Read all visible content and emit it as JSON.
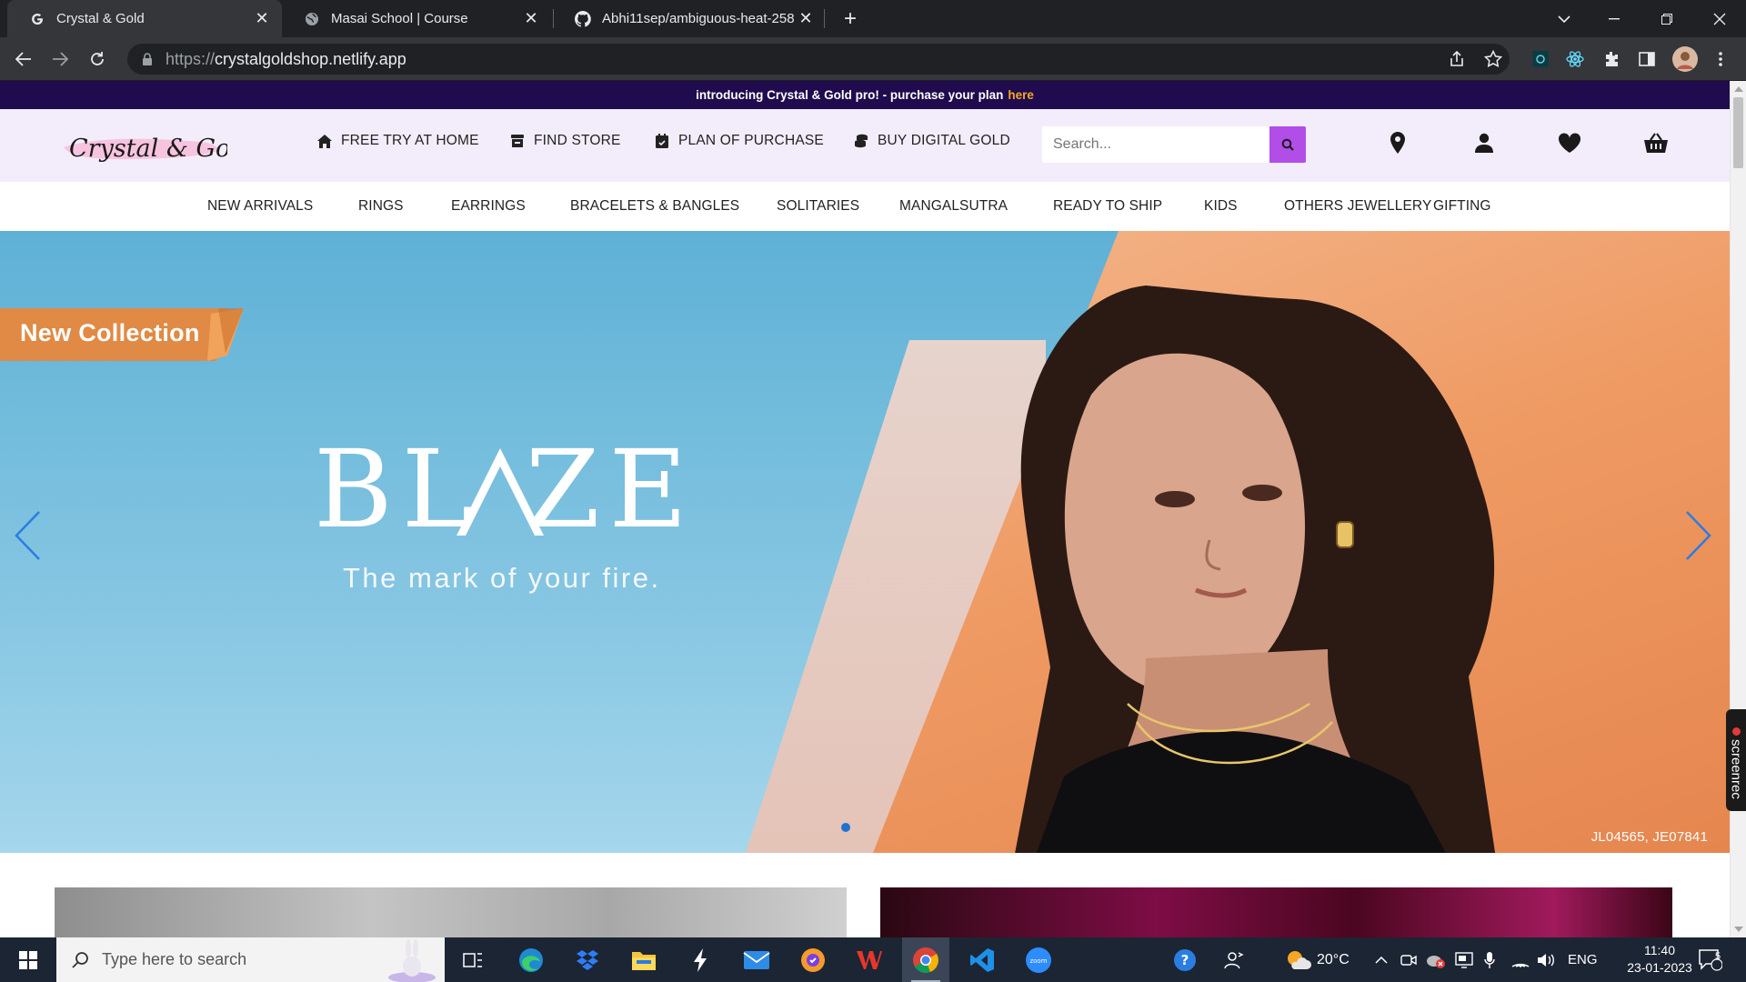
{
  "browser": {
    "tabs": [
      {
        "title": "Crystal & Gold",
        "active": true
      },
      {
        "title": "Masai School | Course",
        "active": false
      },
      {
        "title": "Abhi11sep/ambiguous-heat-258",
        "active": false
      }
    ],
    "url_scheme": "https://",
    "url_host": "crystalgoldshop.netlify.app"
  },
  "announcement": {
    "text": "introducing Crystal & Gold pro! - purchase your plan",
    "link": "here"
  },
  "header": {
    "logo_text": "Crystal & Gold",
    "links": [
      {
        "label": "FREE TRY AT HOME",
        "icon": "home-icon"
      },
      {
        "label": "FIND STORE",
        "icon": "store-icon"
      },
      {
        "label": "PLAN OF PURCHASE",
        "icon": "calendar-icon"
      },
      {
        "label": "BUY DIGITAL GOLD",
        "icon": "coins-icon"
      }
    ],
    "search_placeholder": "Search...",
    "icons": [
      "location-pin-icon",
      "user-icon",
      "heart-icon",
      "basket-icon"
    ]
  },
  "categories": [
    "NEW ARRIVALS",
    "RINGS",
    "EARRINGS",
    "BRACELETS & BANGLES",
    "SOLITARIES",
    "MANGALSUTRA",
    "READY TO SHIP",
    "KIDS",
    "OTHERS JEWELLERY",
    "GIFTING"
  ],
  "hero": {
    "ribbon": "New Collection",
    "headline": "BL  ZE",
    "tagline": "The mark of your fire.",
    "sku": "JL04565, JE07841",
    "accent": "#1e73d2"
  },
  "side_tab": "screenrec",
  "taskbar": {
    "search_placeholder": "Type here to search",
    "weather": "20°C",
    "lang": "ENG",
    "time": "11:40",
    "date": "23-01-2023",
    "notifications": "5"
  }
}
